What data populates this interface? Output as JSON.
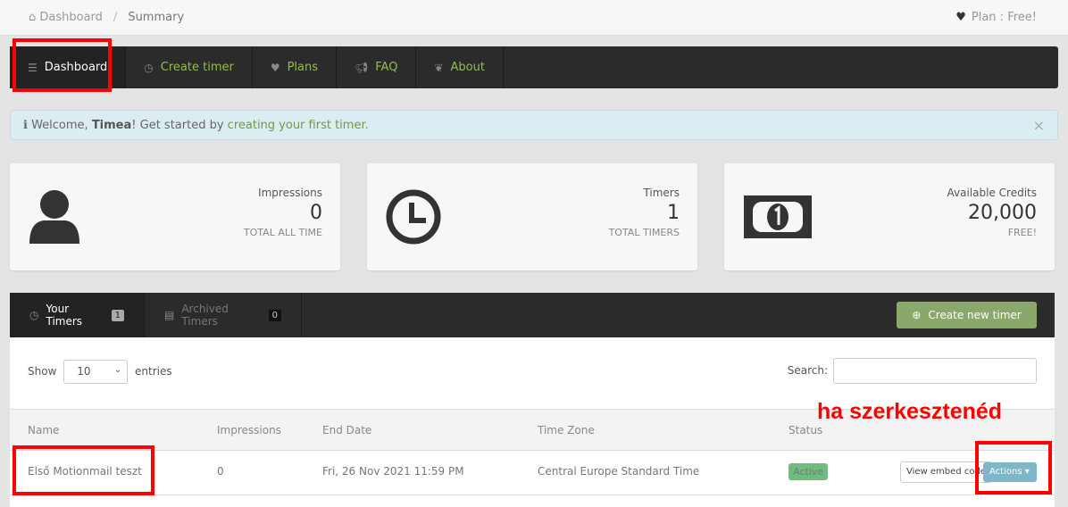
{
  "breadcrumb": {
    "home": "Dashboard",
    "current": "Summary"
  },
  "plan": {
    "label": "Plan : Free!"
  },
  "nav": [
    {
      "label": "Dashboard",
      "icon": "list-icon"
    },
    {
      "label": "Create timer",
      "icon": "clock-icon"
    },
    {
      "label": "Plans",
      "icon": "heart-icon"
    },
    {
      "label": "FAQ",
      "icon": "megaphone-icon"
    },
    {
      "label": "About",
      "icon": "leaf-icon"
    }
  ],
  "alert": {
    "prefix": "Welcome, ",
    "name": "Timea",
    "middle": "! Get started by ",
    "link": "creating your first timer."
  },
  "stats": [
    {
      "label": "Impressions",
      "value": "0",
      "sub": "TOTAL ALL TIME",
      "icon": "user-icon"
    },
    {
      "label": "Timers",
      "value": "1",
      "sub": "TOTAL TIMERS",
      "icon": "clock-icon"
    },
    {
      "label": "Available Credits",
      "value": "20,000",
      "sub": "FREE!",
      "icon": "money-icon"
    }
  ],
  "tabs": [
    {
      "label": "Your Timers",
      "count": "1"
    },
    {
      "label": "Archived Timers",
      "count": "0"
    }
  ],
  "create_button": "Create new timer",
  "table": {
    "show": "Show",
    "entries_value": "10",
    "entries": "entries",
    "search_label": "Search:",
    "search_value": "",
    "columns": [
      "Name",
      "Impressions",
      "End Date",
      "Time Zone",
      "Status"
    ],
    "rows": [
      {
        "name": "Első Motionmail teszt",
        "impressions": "0",
        "end_date": "Fri, 26 Nov 2021 11:59 PM",
        "time_zone": "Central Europe Standard Time",
        "status": "Active",
        "embed": "View embed code",
        "actions": "Actions"
      }
    ]
  },
  "annotation": "ha szerkesztenéd",
  "colors": {
    "nav_bg": "#2b2b2b",
    "link_green": "#8fbf4b",
    "status_active": "#6dbd7f",
    "actions": "#7fb7c8",
    "annotation": "#ff0000"
  }
}
